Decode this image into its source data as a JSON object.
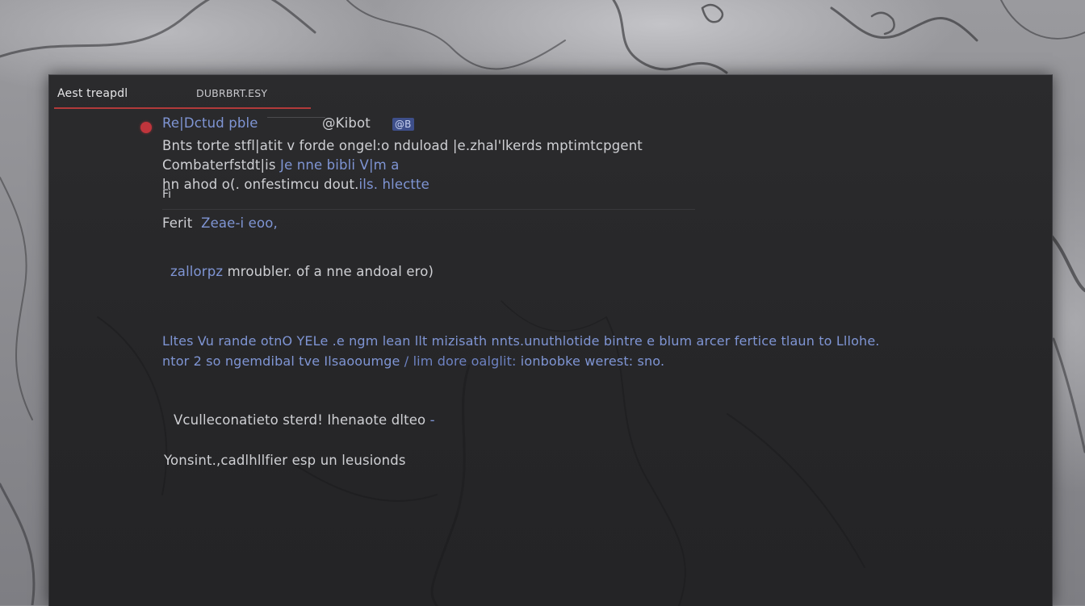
{
  "tabs": {
    "active_label": "Aest treapdl",
    "inactive_label": "DUBRBRT.ESY"
  },
  "header_row": {
    "title": "Re|Dctud pble",
    "link": "@Kibot",
    "badge": "@B"
  },
  "description": {
    "line1_a": "Bnts torte stfl|atit v",
    "line1_b": "forde",
    "line1_c": "ongel:o nduload |e.zhal'lkerds mptimtcpgent",
    "line2_a": "Combaterfstdt|is",
    "line2_b": "Je nne bibli V|m a",
    "line3_a": "hn ahod o(.",
    "line3_b": "onfestimcu dout.",
    "line3_c": "ils. hlectte",
    "line4": "Fi"
  },
  "field_row": {
    "label": "Ferit",
    "value": "Zeae-i eoo,"
  },
  "note_row": {
    "prefix": "zallorpz",
    "text": "mroubler. of a nne andoal ero)"
  },
  "warning": {
    "line1": "Lltes Vu rande otnO YELe .e ngm lean llt mizisath nnts.unuthlotide bintre e blum arcer fertice tlaun to Lllohe.",
    "line2_a": "ntor 2 so  ngemdibal tve Ilsaooumge",
    "line2_b": "/ lim dore oalglit: ",
    "line2_c": "ionbobke werest: sno."
  },
  "option_row": {
    "text": "Vculleconatieto sterd! Ihenaote dlteo",
    "suffix": "-"
  },
  "footer_row": {
    "text": "Yonsint.,cadlhllfier esp un leusionds"
  },
  "colors": {
    "accent_red": "#b23a3a",
    "text_blue": "#7f95d4",
    "text_fg": "#cfd0d4",
    "window_bg": "#2b2b2d"
  }
}
